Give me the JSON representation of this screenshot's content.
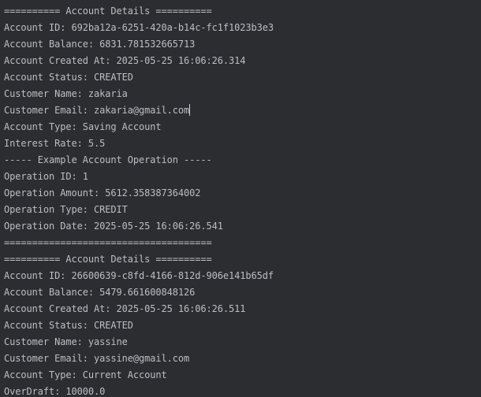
{
  "console": {
    "lines": [
      "========== Account Details ==========",
      "Account ID: 692ba12a-6251-420a-b14c-fc1f1023b3e3",
      "Account Balance: 6831.781532665713",
      "Account Created At: 2025-05-25 16:06:26.314",
      "Account Status: CREATED",
      "Customer Name: zakaria",
      "Customer Email: zakaria@gmail.com",
      "Account Type: Saving Account",
      "Interest Rate: 5.5",
      "----- Example Account Operation -----",
      "Operation ID: 1",
      "Operation Amount: 5612.358387364002",
      "Operation Type: CREDIT",
      "Operation Date: 2025-05-25 16:06:26.541",
      "=====================================",
      "========== Account Details ==========",
      "Account ID: 26600639-c8fd-4166-812d-906e141b65df",
      "Account Balance: 5479.661600848126",
      "Account Created At: 2025-05-25 16:06:26.511",
      "Account Status: CREATED",
      "Customer Name: yassine",
      "Customer Email: yassine@gmail.com",
      "Account Type: Current Account",
      "OverDraft: 10000.0"
    ]
  },
  "colors": {
    "background": "#2b2d30",
    "text": "#bcbec4",
    "caret": "#ced0d6"
  }
}
